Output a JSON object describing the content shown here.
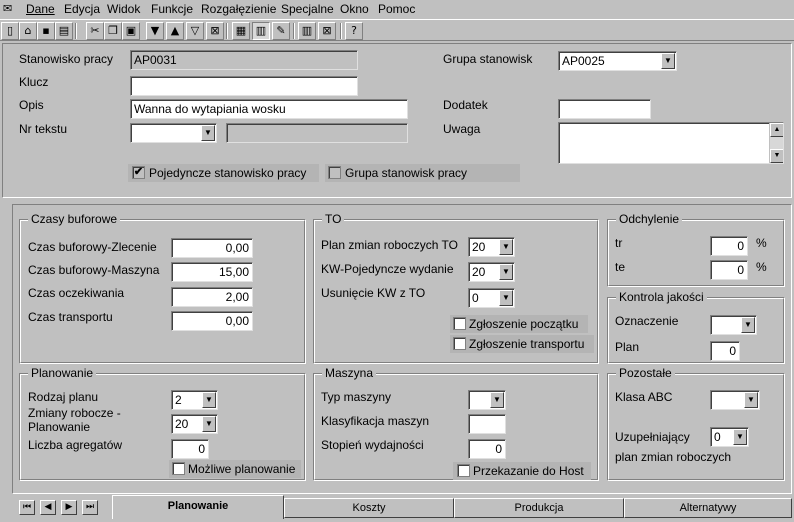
{
  "menu": [
    "Dane",
    "Edycja",
    "Widok",
    "Funkcje",
    "Rozgałęzienie",
    "Specjalne",
    "Okno",
    "Pomoc"
  ],
  "toolbar_icons": [
    "new-icon",
    "open-icon",
    "save-icon",
    "print-icon",
    "cut-icon",
    "copy-icon",
    "paste-icon",
    "dropdown-icon",
    "up-icon",
    "filter-icon",
    "clear-filter-icon",
    "table-icon",
    "form-icon",
    "edit-icon",
    "columns-icon",
    "tree-icon",
    "help-icon"
  ],
  "header": {
    "stanowisko_label": "Stanowisko pracy",
    "stanowisko_value": "AP0031",
    "klucz_label": "Klucz",
    "klucz_value": "",
    "opis_label": "Opis",
    "opis_value": "Wanna do wytapiania wosku",
    "nrtekstu_label": "Nr tekstu",
    "nrtekstu_value": "",
    "nrtekstu_extra": "",
    "grupa_label": "Grupa stanowisk",
    "grupa_value": "AP0025",
    "dodatek_label": "Dodatek",
    "dodatek_value": "",
    "uwaga_label": "Uwaga",
    "uwaga_value": "",
    "check_pojedyncze_label": "Pojedyncze stanowisko pracy",
    "check_pojedyncze_checked": "✔",
    "check_grupa_label": "Grupa stanowisk pracy",
    "check_grupa_checked": ""
  },
  "czasy": {
    "title": "Czasy buforowe",
    "rows": [
      {
        "label": "Czas buforowy-Zlecenie",
        "value": "0,00"
      },
      {
        "label": "Czas buforowy-Maszyna",
        "value": "15,00"
      },
      {
        "label": "Czas oczekiwania",
        "value": "2,00"
      },
      {
        "label": "Czas transportu",
        "value": "0,00"
      }
    ]
  },
  "to": {
    "title": "TO",
    "rows": [
      {
        "label": "Plan zmian roboczych TO",
        "value": "20"
      },
      {
        "label": "KW-Pojedyncze wydanie",
        "value": "20"
      },
      {
        "label": "Usunięcie KW z TO",
        "value": "0"
      }
    ],
    "check_poczatek": "Zgłoszenie początku",
    "check_transport": "Zgłoszenie transportu"
  },
  "odchylenie": {
    "title": "Odchylenie",
    "tr_label": "tr",
    "tr_value": "0",
    "tr_unit": "%",
    "te_label": "te",
    "te_value": "0",
    "te_unit": "%"
  },
  "kontrola": {
    "title": "Kontrola jakości",
    "oznaczenie_label": "Oznaczenie",
    "oznaczenie_value": "",
    "plan_label": "Plan",
    "plan_value": "0"
  },
  "planowanie": {
    "title": "Planowanie",
    "rodzaj_label": "Rodzaj planu",
    "rodzaj_value": "2",
    "zmiany_label1": "Zmiany robocze -",
    "zmiany_label2": "Planowanie",
    "zmiany_value": "20",
    "agregaty_label": "Liczba agregatów",
    "agregaty_value": "0",
    "check_mozliwe": "Możliwe planowanie"
  },
  "maszyna": {
    "title": "Maszyna",
    "typ_label": "Typ maszyny",
    "typ_value": "",
    "klas_label": "Klasyfikacja maszyn",
    "klas_value": "",
    "stopien_label": "Stopień wydajności",
    "stopien_value": "0",
    "check_host": "Przekazanie do Host"
  },
  "pozostale": {
    "title": "Pozostałe",
    "abc_label": "Klasa ABC",
    "abc_value": "",
    "uzup_label1": "Uzupełniający",
    "uzup_label2": "plan zmian roboczych",
    "uzup_value": "0"
  },
  "tabs": [
    "Planowanie",
    "Koszty",
    "Produkcja",
    "Alternatywy"
  ],
  "nav": [
    "⏮",
    "◀",
    "▶",
    "⏭"
  ]
}
